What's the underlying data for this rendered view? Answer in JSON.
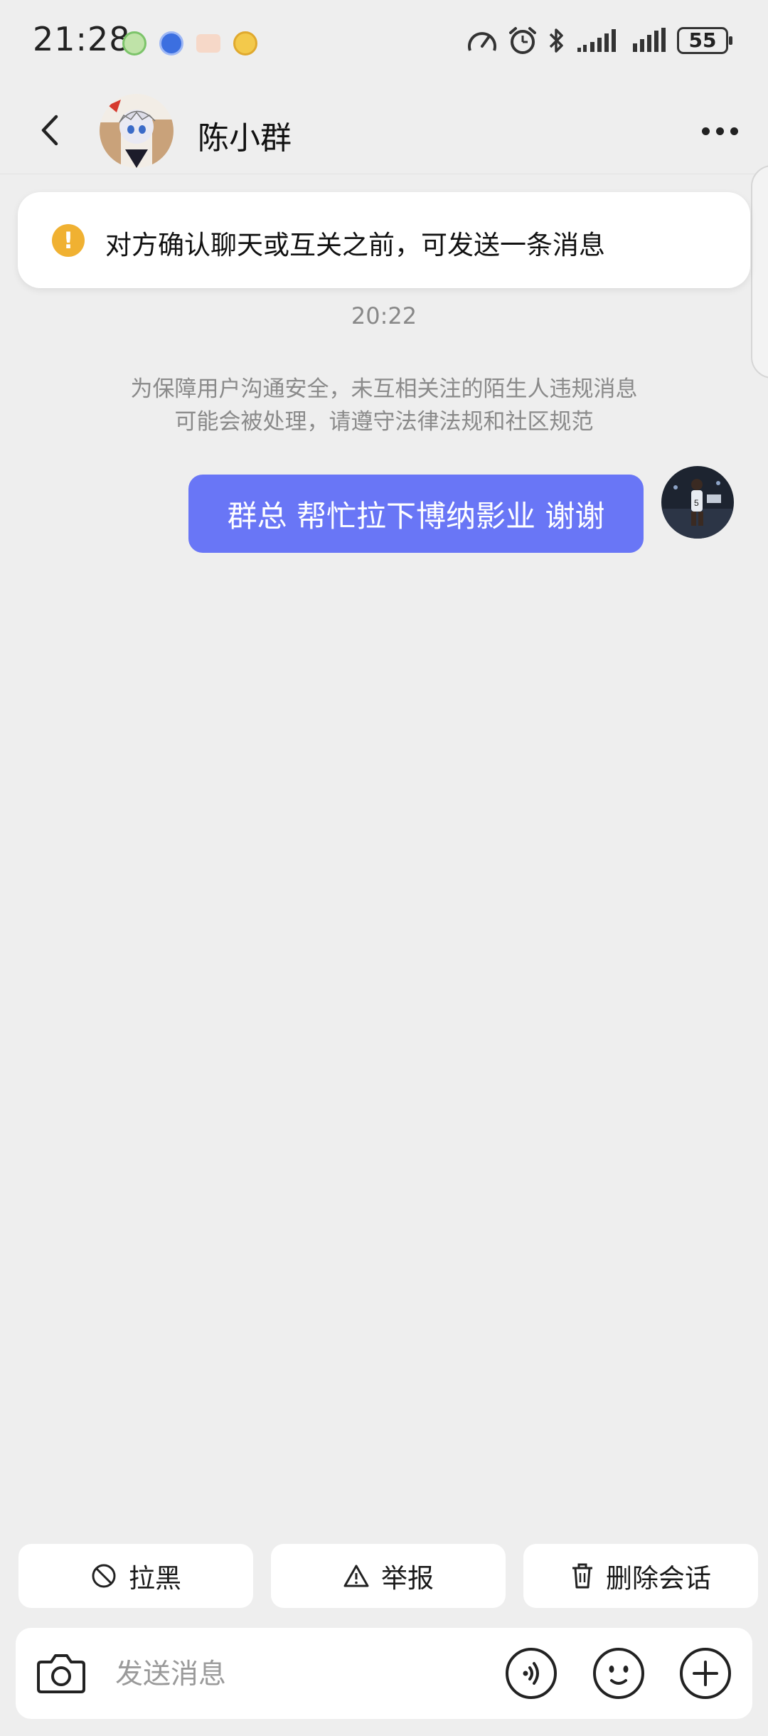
{
  "status_bar": {
    "time": "21:28",
    "battery": "55",
    "app_icons": [
      "green-app-icon",
      "blue-app-icon",
      "mail-app-icon",
      "emoji-app-icon"
    ],
    "indicators": [
      "speedometer-icon",
      "alarm-icon",
      "bluetooth-icon",
      "signal-icon-1",
      "signal-icon-2"
    ]
  },
  "header": {
    "contact_name": "陈小群",
    "back_icon": "chevron-left-icon",
    "more_icon": "more-dots-icon"
  },
  "notice": {
    "text": "对方确认聊天或互关之前，可发送一条消息",
    "icon": "warning-circle-icon",
    "icon_color": "#f0b132"
  },
  "chat": {
    "timestamp": "20:22",
    "safety_line1": "为保障用户沟通安全，未互相关注的陌生人违规消息",
    "safety_line2": "可能会被处理，请遵守法律法规和社区规范",
    "messages": [
      {
        "from": "me",
        "text": "群总 帮忙拉下博纳影业 谢谢",
        "bubble_color": "#6976f6"
      }
    ]
  },
  "actions": {
    "block_label": "拉黑",
    "report_label": "举报",
    "delete_label": "删除会话"
  },
  "input_bar": {
    "placeholder": "发送消息",
    "icons": [
      "camera-icon",
      "voice-icon",
      "emoji-icon",
      "plus-icon"
    ]
  },
  "colors": {
    "background": "#eeeeee",
    "accent": "#6976f6",
    "warning": "#f0b132"
  }
}
